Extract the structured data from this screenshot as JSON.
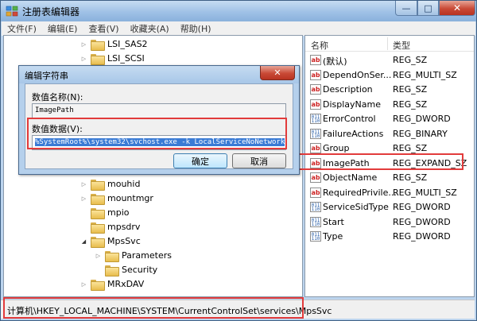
{
  "window": {
    "title": "注册表编辑器",
    "minimize_glyph": "—",
    "maximize_glyph": "□",
    "close_glyph": "✕"
  },
  "menu": [
    "文件(F)",
    "编辑(E)",
    "查看(V)",
    "收藏夹(A)",
    "帮助(H)"
  ],
  "tree": {
    "items": [
      {
        "label": "LSI_SAS2",
        "expanded": false
      },
      {
        "label": "LSI_SCSI",
        "expanded": false
      },
      {
        "label": "mouhid",
        "expanded": false
      },
      {
        "label": "mountmgr",
        "expanded": false
      },
      {
        "label": "mpio",
        "expanded": false
      },
      {
        "label": "mpsdrv",
        "expanded": false
      },
      {
        "label": "MpsSvc",
        "expanded": true
      },
      {
        "label": "Parameters",
        "expanded": false
      },
      {
        "label": "Security",
        "expanded": false
      },
      {
        "label": "MRxDAV",
        "expanded": false
      }
    ]
  },
  "values_list": {
    "header_name": "名称",
    "header_type": "类型",
    "rows": [
      {
        "name": "(默认)",
        "type": "REG_SZ",
        "icon": "string-value-icon"
      },
      {
        "name": "DependOnSer...",
        "type": "REG_MULTI_SZ",
        "icon": "string-value-icon"
      },
      {
        "name": "Description",
        "type": "REG_SZ",
        "icon": "string-value-icon"
      },
      {
        "name": "DisplayName",
        "type": "REG_SZ",
        "icon": "string-value-icon"
      },
      {
        "name": "ErrorControl",
        "type": "REG_DWORD",
        "icon": "binary-value-icon"
      },
      {
        "name": "FailureActions",
        "type": "REG_BINARY",
        "icon": "binary-value-icon"
      },
      {
        "name": "Group",
        "type": "REG_SZ",
        "icon": "string-value-icon"
      },
      {
        "name": "ImagePath",
        "type": "REG_EXPAND_SZ",
        "icon": "string-value-icon"
      },
      {
        "name": "ObjectName",
        "type": "REG_SZ",
        "icon": "string-value-icon"
      },
      {
        "name": "RequiredPrivile...",
        "type": "REG_MULTI_SZ",
        "icon": "string-value-icon"
      },
      {
        "name": "ServiceSidType",
        "type": "REG_DWORD",
        "icon": "binary-value-icon"
      },
      {
        "name": "Start",
        "type": "REG_DWORD",
        "icon": "binary-value-icon"
      },
      {
        "name": "Type",
        "type": "REG_DWORD",
        "icon": "binary-value-icon"
      }
    ]
  },
  "statusbar": {
    "path": "计算机\\HKEY_LOCAL_MACHINE\\SYSTEM\\CurrentControlSet\\services\\MpsSvc"
  },
  "dialog": {
    "title": "编辑字符串",
    "close_glyph": "✕",
    "name_label": "数值名称(N):",
    "name_value": "ImagePath",
    "data_label": "数值数据(V):",
    "data_value": "%SystemRoot%\\system32\\svchost.exe -k LocalServiceNoNetwork",
    "ok_label": "确定",
    "cancel_label": "取消"
  },
  "colors": {
    "highlight_red": "#e23b3b",
    "selection_blue": "#3a7bd5"
  }
}
